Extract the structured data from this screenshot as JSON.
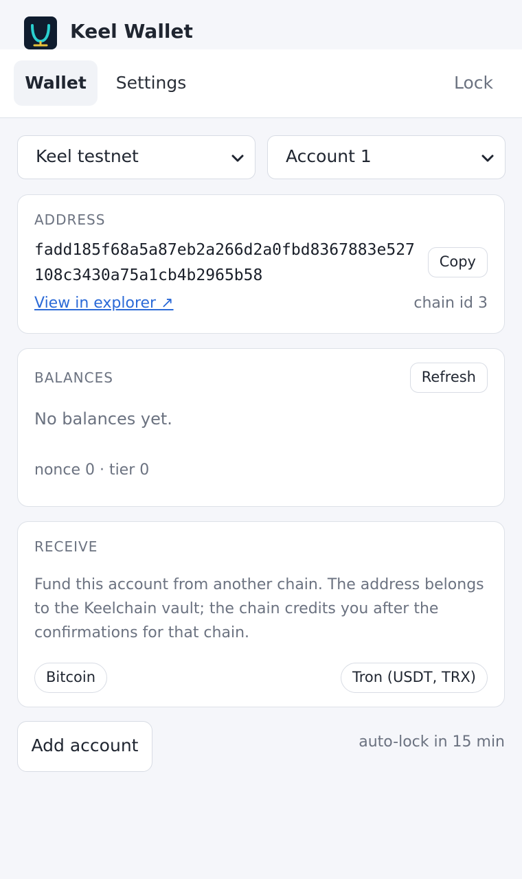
{
  "app": {
    "title": "Keel Wallet",
    "logo_icon": "keel-logo-icon",
    "logo_bg": "#0f1c2e",
    "logo_accent": "#2ad0cf"
  },
  "nav": {
    "tabs": [
      {
        "label": "Wallet",
        "active": true
      },
      {
        "label": "Settings",
        "active": false
      }
    ],
    "lock_label": "Lock"
  },
  "selectors": {
    "network": {
      "value": "Keel testnet",
      "icon": "chevron-down-icon"
    },
    "account": {
      "value": "Account 1",
      "icon": "chevron-down-icon"
    }
  },
  "address_card": {
    "label": "ADDRESS",
    "address": "fadd185f68a5a87eb2a266d2a0fbd8367883e527108c3430a75a1cb4b2965b58",
    "copy_label": "Copy",
    "explorer_label": "View in explorer ↗",
    "chain_id": "chain id 3"
  },
  "balances_card": {
    "label": "BALANCES",
    "refresh_label": "Refresh",
    "empty_text": "No balances yet.",
    "meta": "nonce 0 · tier 0"
  },
  "receive_card": {
    "label": "RECEIVE",
    "description": "Fund this account from another chain. The address belongs to the Keelchain vault; the chain credits you after the confirmations for that chain.",
    "chains": [
      "Bitcoin",
      "Tron (USDT, TRX)"
    ]
  },
  "footer": {
    "add_account_label": "Add account",
    "autolock_text": "auto-lock in 15 min"
  },
  "colors": {
    "link": "#2b6ad7",
    "muted": "#6b7280",
    "background": "#f5f6fa"
  }
}
